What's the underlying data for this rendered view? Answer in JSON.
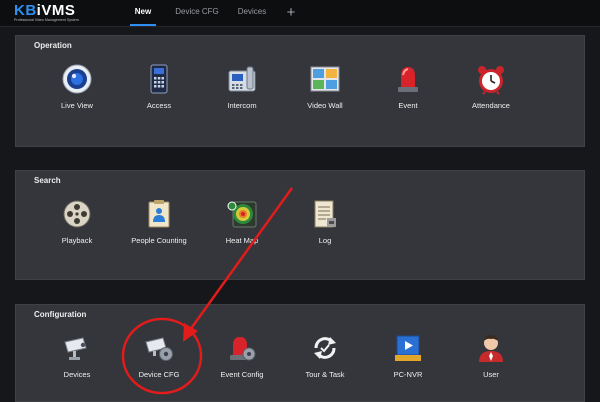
{
  "app": {
    "logo_main": "KBiVMS",
    "logo_subtitle": "Professional Video Management System"
  },
  "tabs": [
    {
      "label": "New",
      "active": true
    },
    {
      "label": "Device CFG",
      "active": false
    },
    {
      "label": "Devices",
      "active": false
    },
    {
      "label": "+",
      "icon": "add-tab-icon"
    }
  ],
  "sections": {
    "operation": {
      "title": "Operation",
      "items": [
        {
          "label": "Live View",
          "icon": "live-view-icon"
        },
        {
          "label": "Access",
          "icon": "access-icon"
        },
        {
          "label": "Intercom",
          "icon": "intercom-icon"
        },
        {
          "label": "Video Wall",
          "icon": "video-wall-icon"
        },
        {
          "label": "Event",
          "icon": "event-alarm-icon"
        },
        {
          "label": "Attendance",
          "icon": "alarm-clock-icon"
        }
      ]
    },
    "search": {
      "title": "Search",
      "items": [
        {
          "label": "Playback",
          "icon": "film-reel-icon"
        },
        {
          "label": "People Counting",
          "icon": "people-counting-icon"
        },
        {
          "label": "Heat Map",
          "icon": "heat-map-icon"
        },
        {
          "label": "Log",
          "icon": "log-icon"
        }
      ]
    },
    "configuration": {
      "title": "Configuration",
      "items": [
        {
          "label": "Devices",
          "icon": "camera-icon"
        },
        {
          "label": "Device CFG",
          "icon": "camera-settings-icon"
        },
        {
          "label": "Event Config",
          "icon": "event-config-icon"
        },
        {
          "label": "Tour & Task",
          "icon": "tour-task-icon"
        },
        {
          "label": "PC-NVR",
          "icon": "pc-nvr-icon"
        },
        {
          "label": "User",
          "icon": "user-icon"
        }
      ]
    }
  },
  "colors": {
    "background": "#15171b",
    "panel": "#34363c",
    "accent": "#2f8ff0",
    "annotation": "#e21b1b"
  }
}
